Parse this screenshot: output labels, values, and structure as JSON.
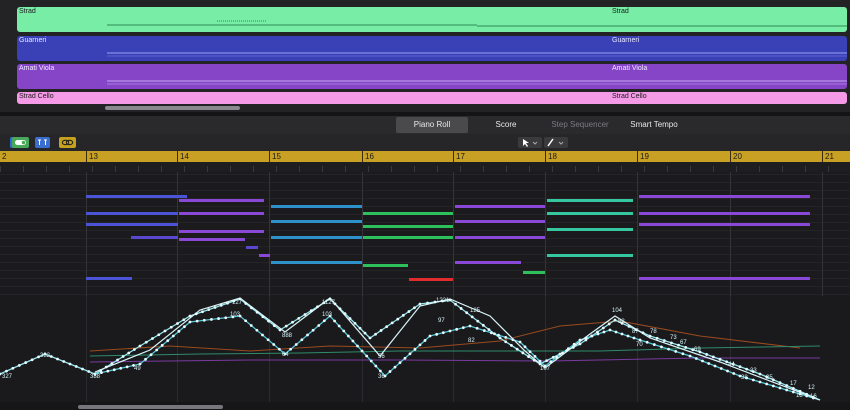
{
  "tracks": [
    {
      "name": "Strad",
      "color": "#7ff0a8",
      "hdr": "#a7f5c4"
    },
    {
      "name": "Guarneri",
      "color": "#3b3fb5",
      "hdr": "#9fa3ee"
    },
    {
      "name": "Amati Viola",
      "color": "#8446c8",
      "hdr": "#c8a9ee"
    },
    {
      "name": "Strad Cello",
      "color": "#f08ae0",
      "hdr": "#f7b3ee"
    }
  ],
  "tabs": {
    "piano_roll": "Piano Roll",
    "score": "Score",
    "step_sequencer": "Step Sequencer",
    "smart_tempo": "Smart Tempo"
  },
  "toolbar": {
    "pointer_tool": "pointer-tool-icon",
    "pencil_tool": "pencil-tool-icon"
  },
  "ruler": {
    "bars": [
      "2",
      "13",
      "14",
      "15",
      "16",
      "17",
      "18",
      "19",
      "20",
      "21"
    ]
  },
  "automation_labels": [
    "327",
    "382",
    "388",
    "49",
    "127",
    "103",
    "1127",
    "103",
    "888",
    "64",
    "1221",
    "97",
    "56",
    "36",
    "82",
    "125",
    "107",
    "104",
    "82",
    "87",
    "78",
    "70",
    "73",
    "67",
    "69",
    "44",
    "33",
    "25",
    "17",
    "12",
    "13",
    "16",
    "38"
  ]
}
